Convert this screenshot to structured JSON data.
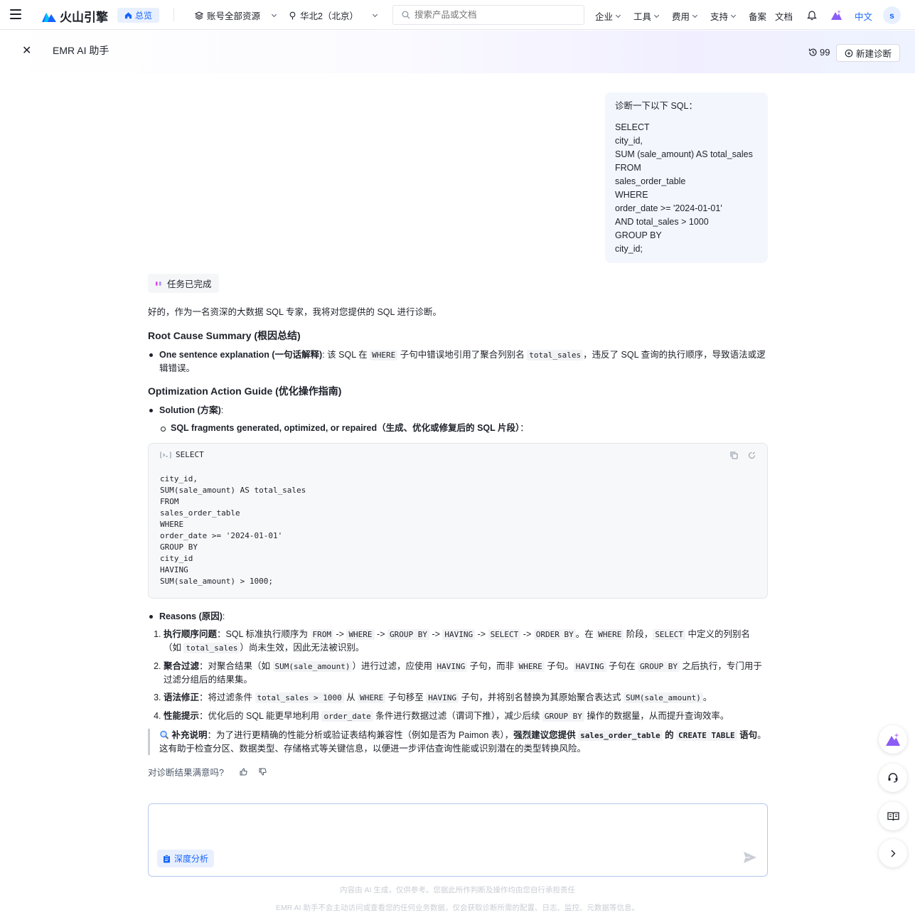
{
  "topnav": {
    "brand": "火山引擎",
    "home_label": "总览",
    "account_label": "账号全部资源",
    "region_label": "华北2（北京）",
    "search_placeholder": "搜索产品或文档",
    "menu": [
      {
        "label": "企业"
      },
      {
        "label": "工具"
      },
      {
        "label": "费用"
      },
      {
        "label": "支持"
      },
      {
        "label": "备案"
      },
      {
        "label": "文档"
      }
    ],
    "language": "中文",
    "avatar_letter": "s"
  },
  "page": {
    "title": "EMR AI 助手",
    "history_count": "99",
    "new_diagnosis_label": "新建诊断"
  },
  "user_message": {
    "question": "诊断一下以下 SQL：",
    "lines": [
      "SELECT",
      "city_id,",
      "SUM (sale_amount) AS total_sales",
      "FROM",
      "sales_order_table",
      "WHERE",
      "order_date >= '2024-01-01'",
      "AND total_sales > 1000",
      "GROUP BY",
      "city_id;"
    ]
  },
  "answer": {
    "status": "任务已完成",
    "intro": "好的，作为一名资深的大数据 SQL 专家，我将对您提供的 SQL 进行诊断。",
    "root_title": "Root Cause Summary (根因总结)",
    "one_sentence_label": "One sentence explanation (一句话解释)",
    "one_sentence_a": ": 该 SQL 在 ",
    "one_sentence_code1": "WHERE",
    "one_sentence_b": " 子句中错误地引用了聚合列别名 ",
    "one_sentence_code2": "total_sales",
    "one_sentence_c": "，违反了 SQL 查询的执行顺序，导致语法或逻辑错误。",
    "opt_title": "Optimization Action Guide (优化操作指南)",
    "solution_label": "Solution (方案)",
    "fragments_label": "SQL fragments generated, optimized, or repaired（生成、优化或修复后的 SQL 片段）",
    "code_first_line": "SELECT",
    "code_body": "city_id,\nSUM(sale_amount) AS total_sales\nFROM\nsales_order_table\nWHERE\norder_date >= '2024-01-01'\nGROUP BY\ncity_id\nHAVING\nSUM(sale_amount) > 1000;",
    "reasons_label": "Reasons (原因)",
    "r1_title": "执行顺序问题",
    "r1_a": "：SQL 标准执行顺序为 ",
    "r1_c1": "FROM",
    "r1_c2": "WHERE",
    "r1_c3": "GROUP BY",
    "r1_c4": "HAVING",
    "r1_c5": "SELECT",
    "r1_c6": "ORDER BY",
    "arrow": " -> ",
    "r1_b": "。在 ",
    "r1_c7": "WHERE",
    "r1_c": " 阶段，",
    "r1_c8": "SELECT",
    "r1_d": " 中定义的列别名（如 ",
    "r1_c9": "total_sales",
    "r1_e": "）尚未生效，因此无法被识别。",
    "r2_title": "聚合过滤",
    "r2_a": "：对聚合结果（如 ",
    "r2_c1": "SUM(sale_amount)",
    "r2_b": "）进行过滤，应使用 ",
    "r2_c2": "HAVING",
    "r2_c": " 子句，而非 ",
    "r2_c3": "WHERE",
    "r2_d": " 子句。",
    "r2_c4": "HAVING",
    "r2_e": " 子句在 ",
    "r2_c5": "GROUP BY",
    "r2_f": " 之后执行，专门用于过滤分组后的结果集。",
    "r3_title": "语法修正",
    "r3_a": "：将过滤条件 ",
    "r3_c1": "total_sales > 1000",
    "r3_b": " 从 ",
    "r3_c2": "WHERE",
    "r3_c": " 子句移至 ",
    "r3_c3": "HAVING",
    "r3_d": " 子句，并将别名替换为其原始聚合表达式 ",
    "r3_c4": "SUM(sale_amount)",
    "r3_e": "。",
    "r4_title": "性能提示",
    "r4_a": "：优化后的 SQL 能更早地利用 ",
    "r4_c1": "order_date",
    "r4_b": " 条件进行数据过滤（谓词下推），减少后续 ",
    "r4_c2": "GROUP BY",
    "r4_c": " 操作的数据量，从而提升查询效率。",
    "note_title": "补充说明",
    "note_a": "：为了进行更精确的性能分析或验证表结构兼容性（例如是否为 Paimon 表），",
    "note_bold_a": "强烈建议您提供 ",
    "note_c1": "sales_order_table",
    "note_bold_b": " 的 ",
    "note_c2": "CREATE TABLE",
    "note_bold_c": " 语句",
    "note_b": "。这有助于检查分区、数据类型、存储格式等关键信息，以便进一步评估查询性能或识别潜在的类型转换风险。",
    "satisfaction": "对诊断结果满意吗?"
  },
  "input": {
    "deep_label": "深度分析"
  },
  "disclaimer": {
    "line1": "内容由 AI 生成，仅供参考。您据此所作判断及操作均由您自行承担责任",
    "line2": "EMR AI 助手不会主动访问或查看您的任何业务数据，仅会获取诊断所需的配置、日志、监控、元数据等信息。"
  }
}
